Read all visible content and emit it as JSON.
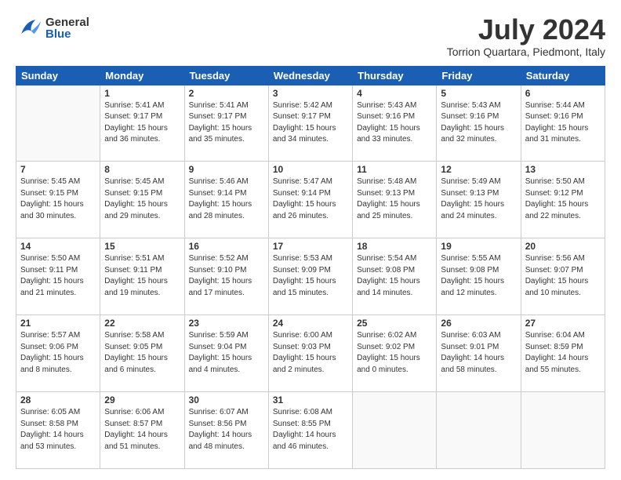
{
  "header": {
    "logo_general": "General",
    "logo_blue": "Blue",
    "month_title": "July 2024",
    "location": "Torrion Quartara, Piedmont, Italy"
  },
  "days_of_week": [
    "Sunday",
    "Monday",
    "Tuesday",
    "Wednesday",
    "Thursday",
    "Friday",
    "Saturday"
  ],
  "weeks": [
    [
      {
        "day": "",
        "info": ""
      },
      {
        "day": "1",
        "info": "Sunrise: 5:41 AM\nSunset: 9:17 PM\nDaylight: 15 hours\nand 36 minutes."
      },
      {
        "day": "2",
        "info": "Sunrise: 5:41 AM\nSunset: 9:17 PM\nDaylight: 15 hours\nand 35 minutes."
      },
      {
        "day": "3",
        "info": "Sunrise: 5:42 AM\nSunset: 9:17 PM\nDaylight: 15 hours\nand 34 minutes."
      },
      {
        "day": "4",
        "info": "Sunrise: 5:43 AM\nSunset: 9:16 PM\nDaylight: 15 hours\nand 33 minutes."
      },
      {
        "day": "5",
        "info": "Sunrise: 5:43 AM\nSunset: 9:16 PM\nDaylight: 15 hours\nand 32 minutes."
      },
      {
        "day": "6",
        "info": "Sunrise: 5:44 AM\nSunset: 9:16 PM\nDaylight: 15 hours\nand 31 minutes."
      }
    ],
    [
      {
        "day": "7",
        "info": "Sunrise: 5:45 AM\nSunset: 9:15 PM\nDaylight: 15 hours\nand 30 minutes."
      },
      {
        "day": "8",
        "info": "Sunrise: 5:45 AM\nSunset: 9:15 PM\nDaylight: 15 hours\nand 29 minutes."
      },
      {
        "day": "9",
        "info": "Sunrise: 5:46 AM\nSunset: 9:14 PM\nDaylight: 15 hours\nand 28 minutes."
      },
      {
        "day": "10",
        "info": "Sunrise: 5:47 AM\nSunset: 9:14 PM\nDaylight: 15 hours\nand 26 minutes."
      },
      {
        "day": "11",
        "info": "Sunrise: 5:48 AM\nSunset: 9:13 PM\nDaylight: 15 hours\nand 25 minutes."
      },
      {
        "day": "12",
        "info": "Sunrise: 5:49 AM\nSunset: 9:13 PM\nDaylight: 15 hours\nand 24 minutes."
      },
      {
        "day": "13",
        "info": "Sunrise: 5:50 AM\nSunset: 9:12 PM\nDaylight: 15 hours\nand 22 minutes."
      }
    ],
    [
      {
        "day": "14",
        "info": "Sunrise: 5:50 AM\nSunset: 9:11 PM\nDaylight: 15 hours\nand 21 minutes."
      },
      {
        "day": "15",
        "info": "Sunrise: 5:51 AM\nSunset: 9:11 PM\nDaylight: 15 hours\nand 19 minutes."
      },
      {
        "day": "16",
        "info": "Sunrise: 5:52 AM\nSunset: 9:10 PM\nDaylight: 15 hours\nand 17 minutes."
      },
      {
        "day": "17",
        "info": "Sunrise: 5:53 AM\nSunset: 9:09 PM\nDaylight: 15 hours\nand 15 minutes."
      },
      {
        "day": "18",
        "info": "Sunrise: 5:54 AM\nSunset: 9:08 PM\nDaylight: 15 hours\nand 14 minutes."
      },
      {
        "day": "19",
        "info": "Sunrise: 5:55 AM\nSunset: 9:08 PM\nDaylight: 15 hours\nand 12 minutes."
      },
      {
        "day": "20",
        "info": "Sunrise: 5:56 AM\nSunset: 9:07 PM\nDaylight: 15 hours\nand 10 minutes."
      }
    ],
    [
      {
        "day": "21",
        "info": "Sunrise: 5:57 AM\nSunset: 9:06 PM\nDaylight: 15 hours\nand 8 minutes."
      },
      {
        "day": "22",
        "info": "Sunrise: 5:58 AM\nSunset: 9:05 PM\nDaylight: 15 hours\nand 6 minutes."
      },
      {
        "day": "23",
        "info": "Sunrise: 5:59 AM\nSunset: 9:04 PM\nDaylight: 15 hours\nand 4 minutes."
      },
      {
        "day": "24",
        "info": "Sunrise: 6:00 AM\nSunset: 9:03 PM\nDaylight: 15 hours\nand 2 minutes."
      },
      {
        "day": "25",
        "info": "Sunrise: 6:02 AM\nSunset: 9:02 PM\nDaylight: 15 hours\nand 0 minutes."
      },
      {
        "day": "26",
        "info": "Sunrise: 6:03 AM\nSunset: 9:01 PM\nDaylight: 14 hours\nand 58 minutes."
      },
      {
        "day": "27",
        "info": "Sunrise: 6:04 AM\nSunset: 8:59 PM\nDaylight: 14 hours\nand 55 minutes."
      }
    ],
    [
      {
        "day": "28",
        "info": "Sunrise: 6:05 AM\nSunset: 8:58 PM\nDaylight: 14 hours\nand 53 minutes."
      },
      {
        "day": "29",
        "info": "Sunrise: 6:06 AM\nSunset: 8:57 PM\nDaylight: 14 hours\nand 51 minutes."
      },
      {
        "day": "30",
        "info": "Sunrise: 6:07 AM\nSunset: 8:56 PM\nDaylight: 14 hours\nand 48 minutes."
      },
      {
        "day": "31",
        "info": "Sunrise: 6:08 AM\nSunset: 8:55 PM\nDaylight: 14 hours\nand 46 minutes."
      },
      {
        "day": "",
        "info": ""
      },
      {
        "day": "",
        "info": ""
      },
      {
        "day": "",
        "info": ""
      }
    ]
  ]
}
